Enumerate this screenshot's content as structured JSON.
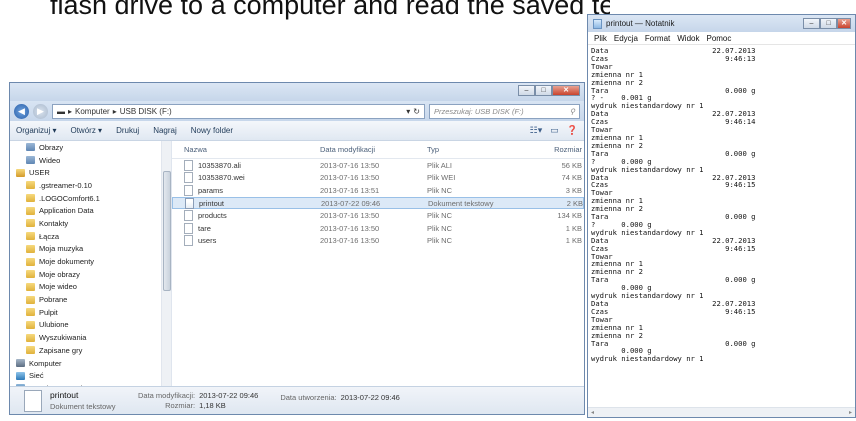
{
  "heading": "flash drive to a computer and read the saved text file usi",
  "explorer": {
    "breadcrumb": [
      "Komputer",
      "USB DISK (F:)"
    ],
    "search_placeholder": "Przeszukaj: USB DISK (F:)",
    "toolbar": [
      "Organizuj ▾",
      "Otwórz ▾",
      "Drukuj",
      "Nagraj",
      "Nowy folder"
    ],
    "nav_items": [
      {
        "label": "Obrazy",
        "indent": 1,
        "icon": "lib"
      },
      {
        "label": "Wideo",
        "indent": 1,
        "icon": "lib"
      },
      {
        "label": "USER",
        "indent": 0,
        "icon": "user"
      },
      {
        "label": ".gstreamer-0.10",
        "indent": 1,
        "icon": "folder"
      },
      {
        "label": ".LOGOComfort6.1",
        "indent": 1,
        "icon": "folder"
      },
      {
        "label": "Application Data",
        "indent": 1,
        "icon": "folder"
      },
      {
        "label": "Kontakty",
        "indent": 1,
        "icon": "folder"
      },
      {
        "label": "Łącza",
        "indent": 1,
        "icon": "folder"
      },
      {
        "label": "Moja muzyka",
        "indent": 1,
        "icon": "folder"
      },
      {
        "label": "Moje dokumenty",
        "indent": 1,
        "icon": "folder"
      },
      {
        "label": "Moje obrazy",
        "indent": 1,
        "icon": "folder"
      },
      {
        "label": "Moje wideo",
        "indent": 1,
        "icon": "folder"
      },
      {
        "label": "Pobrane",
        "indent": 1,
        "icon": "folder"
      },
      {
        "label": "Pulpit",
        "indent": 1,
        "icon": "folder"
      },
      {
        "label": "Ulubione",
        "indent": 1,
        "icon": "folder"
      },
      {
        "label": "Wyszukiwania",
        "indent": 1,
        "icon": "folder"
      },
      {
        "label": "Zapisane gry",
        "indent": 1,
        "icon": "folder"
      },
      {
        "label": "Komputer",
        "indent": 0,
        "icon": "comp"
      },
      {
        "label": "Sieć",
        "indent": 0,
        "icon": "net"
      },
      {
        "label": "Panel sterowania",
        "indent": 0,
        "icon": "panel"
      }
    ],
    "columns": [
      "Nazwa",
      "Data modyfikacji",
      "Typ",
      "Rozmiar"
    ],
    "files": [
      {
        "name": "10353870.ali",
        "date": "2013-07-16 13:50",
        "type": "Plik ALI",
        "size": "56 KB",
        "selected": false
      },
      {
        "name": "10353870.wei",
        "date": "2013-07-16 13:50",
        "type": "Plik WEI",
        "size": "74 KB",
        "selected": false
      },
      {
        "name": "params",
        "date": "2013-07-16 13:51",
        "type": "Plik NC",
        "size": "3 KB",
        "selected": false
      },
      {
        "name": "printout",
        "date": "2013-07-22 09:46",
        "type": "Dokument tekstowy",
        "size": "2 KB",
        "selected": true
      },
      {
        "name": "products",
        "date": "2013-07-16 13:50",
        "type": "Plik NC",
        "size": "134 KB",
        "selected": false
      },
      {
        "name": "tare",
        "date": "2013-07-16 13:50",
        "type": "Plik NC",
        "size": "1 KB",
        "selected": false
      },
      {
        "name": "users",
        "date": "2013-07-16 13:50",
        "type": "Plik NC",
        "size": "1 KB",
        "selected": false
      }
    ],
    "status": {
      "name": "printout",
      "type": "Dokument tekstowy",
      "modified_label": "Data modyfikacji:",
      "modified_value": "2013-07-22 09:46",
      "size_label": "Rozmiar:",
      "size_value": "1,18 KB",
      "created_label": "Data utworzenia:",
      "created_value": "2013-07-22 09:46"
    }
  },
  "notepad": {
    "title": "printout — Notatnik",
    "menu": [
      "Plik",
      "Edycja",
      "Format",
      "Widok",
      "Pomoc"
    ],
    "text": "Data                        22.07.2013\nCzas                           9:46:13\nTowar\nzmienna nr 1\nzmienna nr 2\nTara                           0.000 g\n? -    0.001 g\nwydruk niestandardowy nr 1\nData                        22.07.2013\nCzas                           9:46:14\nTowar\nzmienna nr 1\nzmienna nr 2\nTara                           0.000 g\n?      0.000 g\nwydruk niestandardowy nr 1\nData                        22.07.2013\nCzas                           9:46:15\nTowar\nzmienna nr 1\nzmienna nr 2\nTara                           0.000 g\n?      0.000 g\nwydruk niestandardowy nr 1\nData                        22.07.2013\nCzas                           9:46:15\nTowar\nzmienna nr 1\nzmienna nr 2\nTara                           0.000 g\n       0.000 g\nwydruk niestandardowy nr 1\nData                        22.07.2013\nCzas                           9:46:15\nTowar\nzmienna nr 1\nzmienna nr 2\nTara                           0.000 g\n       0.000 g\nwydruk niestandardowy nr 1"
  }
}
